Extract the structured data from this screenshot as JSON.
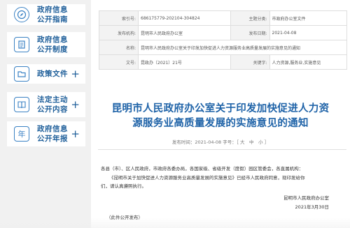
{
  "sidebar": {
    "items": [
      {
        "label_line1": "政府信息",
        "label_line2": "公开指南",
        "icon": "compass-icon",
        "has_plus": false
      },
      {
        "label_line1": "政府信息",
        "label_line2": "公开制度",
        "icon": "document-icon",
        "has_plus": false
      },
      {
        "label_line1": "政策文件",
        "label_line2": "",
        "icon": "folder-icon",
        "has_plus": true,
        "plus": "+"
      },
      {
        "label_line1": "法定主动",
        "label_line2": "公开内容",
        "icon": "book-icon",
        "has_plus": true,
        "plus": "+"
      },
      {
        "label_line1": "政府信息",
        "label_line2": "公开年报",
        "icon": "year-icon",
        "has_plus": true,
        "plus": "+",
        "icon_text": "年"
      }
    ]
  },
  "meta": {
    "index_label": "索引号:",
    "index_value": "686175779-202104-304824",
    "subject_label": "主题分类:",
    "subject_value": "市政府办公室文件",
    "issuer_label": "发布机构:",
    "issuer_value": "昆明市人民政府办公室",
    "date_label": "发布日期:",
    "date_value": "2021-04-08",
    "name_label": "名称:",
    "name_value": "昆明市人民政府办公室关于印发加快促进人力资源服务业高质量发展的实施意见的通知",
    "docno_label": "文号:",
    "docno_value": "昆政办〔2021〕21号",
    "keyword_label": "关键字:",
    "keyword_value": "人力资源,服务业,实施意见"
  },
  "document": {
    "title_line1": "昆明市人民政府办公室关于印发加快促进人力资",
    "title_line2": "源服务业高质量发展的实施意见的通知",
    "publish_meta": "发布时间：2021-04-08 字号：［ 大　中　小 ］",
    "body_line1": "各县（市）、区人民政府，市政府各委办局，各国家级、省级开发（度假）园区管委会，各直属机构：",
    "body_line2": "《昆明市关于加快促进人力资源服务业高质量发展的实施意见》已经市人民政府同意，现印发给你",
    "body_line3": "们，请认真遵照执行。",
    "signature": "昆明市人民政府办公室",
    "sign_date": "2021年3月30日",
    "note": "（此件公开发布）"
  }
}
